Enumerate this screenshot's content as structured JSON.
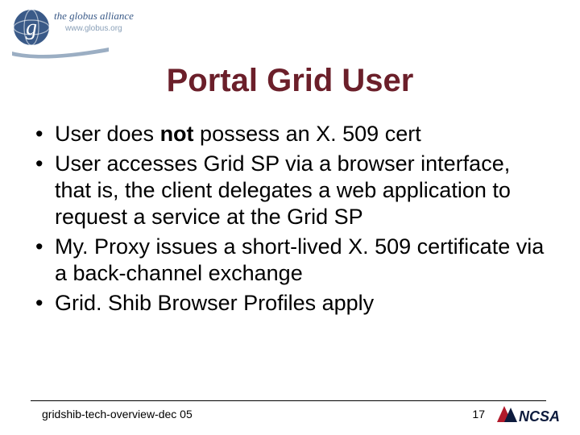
{
  "logo": {
    "top_text": "the globus alliance",
    "sub_text": "www.globus.org"
  },
  "title": "Portal Grid User",
  "bullets": [
    {
      "pre": "User does ",
      "bold": "not",
      "post": " possess an X. 509 cert"
    },
    {
      "pre": "User accesses Grid SP via a browser interface, that is, the client delegates a web application to request a service at the Grid SP",
      "bold": "",
      "post": ""
    },
    {
      "pre": "My. Proxy issues a short-lived X. 509 certificate via a back-channel exchange",
      "bold": "",
      "post": ""
    },
    {
      "pre": "Grid. Shib Browser Profiles apply",
      "bold": "",
      "post": ""
    }
  ],
  "footer": {
    "left": "gridshib-tech-overview-dec 05",
    "page": "17",
    "ncsa": "NCSA"
  },
  "colors": {
    "title": "#6b1f2a",
    "logo_blue": "#3a5a88",
    "ncsa_red": "#b11a2b",
    "ncsa_navy": "#0d1b3d"
  }
}
